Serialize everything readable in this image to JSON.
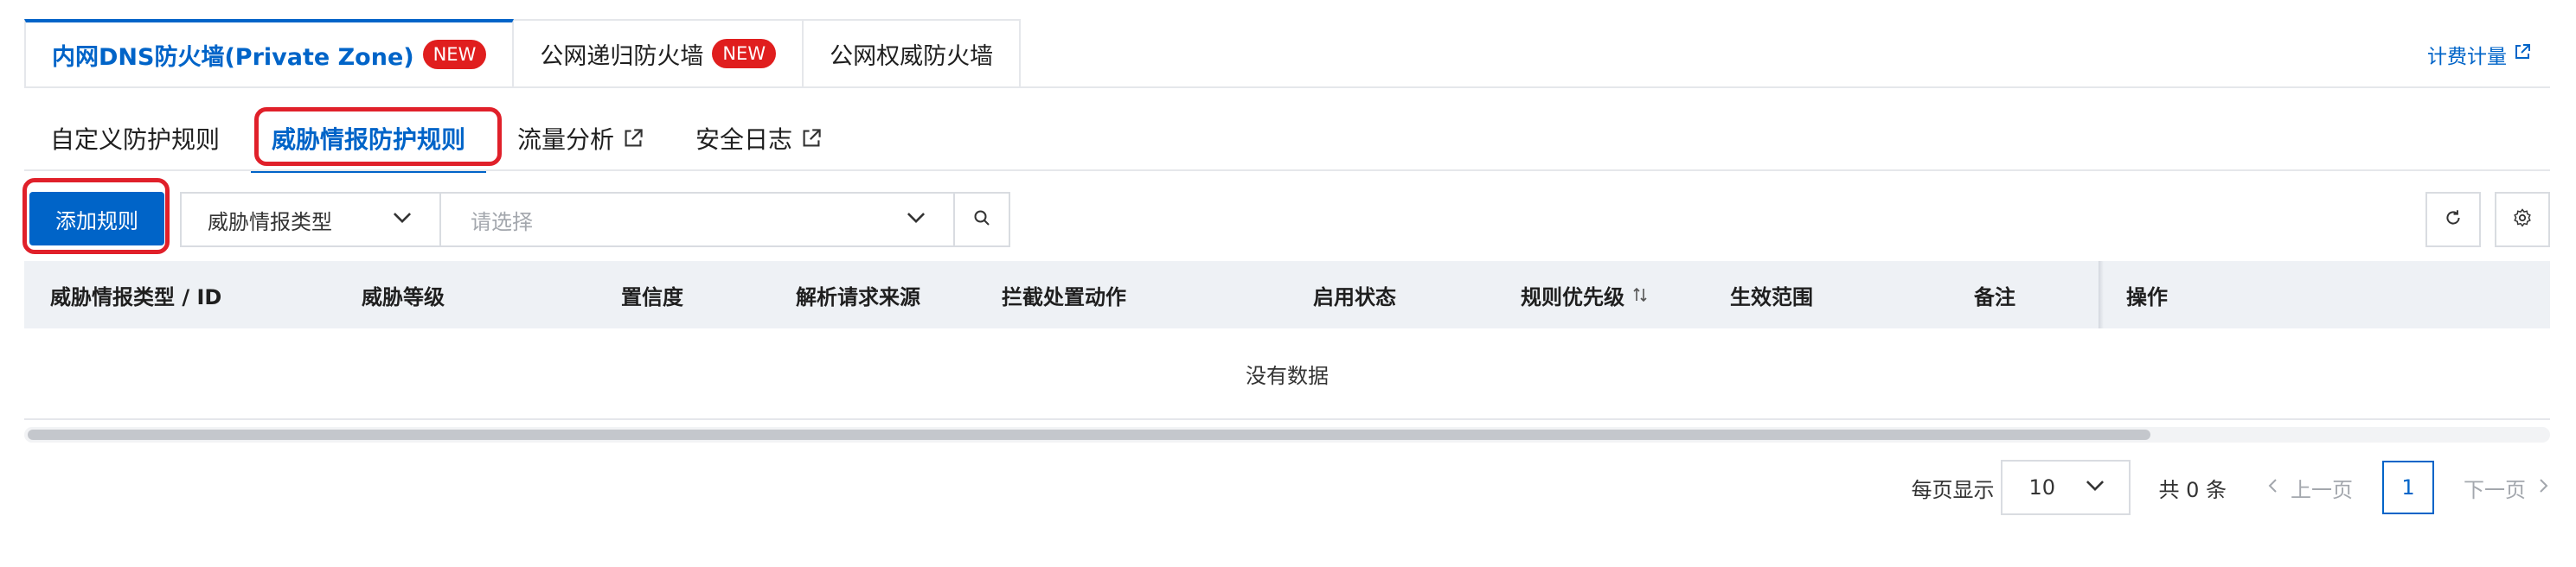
{
  "top_tabs": [
    {
      "label": "内网DNS防火墙(Private Zone)",
      "badge": "NEW",
      "active": true
    },
    {
      "label": "公网递归防火墙",
      "badge": "NEW",
      "active": false
    },
    {
      "label": "公网权威防火墙",
      "badge": "",
      "active": false
    }
  ],
  "billing_link": "计费计量",
  "sub_tabs": [
    {
      "label": "自定义防护规则",
      "external": false,
      "active": false
    },
    {
      "label": "威胁情报防护规则",
      "external": false,
      "active": true
    },
    {
      "label": "流量分析",
      "external": true,
      "active": false
    },
    {
      "label": "安全日志",
      "external": true,
      "active": false
    }
  ],
  "toolbar": {
    "add_button": "添加规则",
    "filter_type": "威胁情报类型",
    "filter_placeholder": "请选择"
  },
  "table": {
    "columns": [
      "威胁情报类型 / ID",
      "威胁等级",
      "置信度",
      "解析请求来源",
      "拦截处置动作",
      "启用状态",
      "规则优先级",
      "生效范围",
      "备注",
      "操作"
    ],
    "empty_text": "没有数据"
  },
  "pagination": {
    "per_page_label": "每页显示",
    "page_size": "10",
    "total_text": "共 0 条",
    "prev": "上一页",
    "current_page": "1",
    "next": "下一页"
  },
  "colors": {
    "primary": "#0064c8",
    "badge": "#e01e1e",
    "highlight": "#e0202a"
  }
}
